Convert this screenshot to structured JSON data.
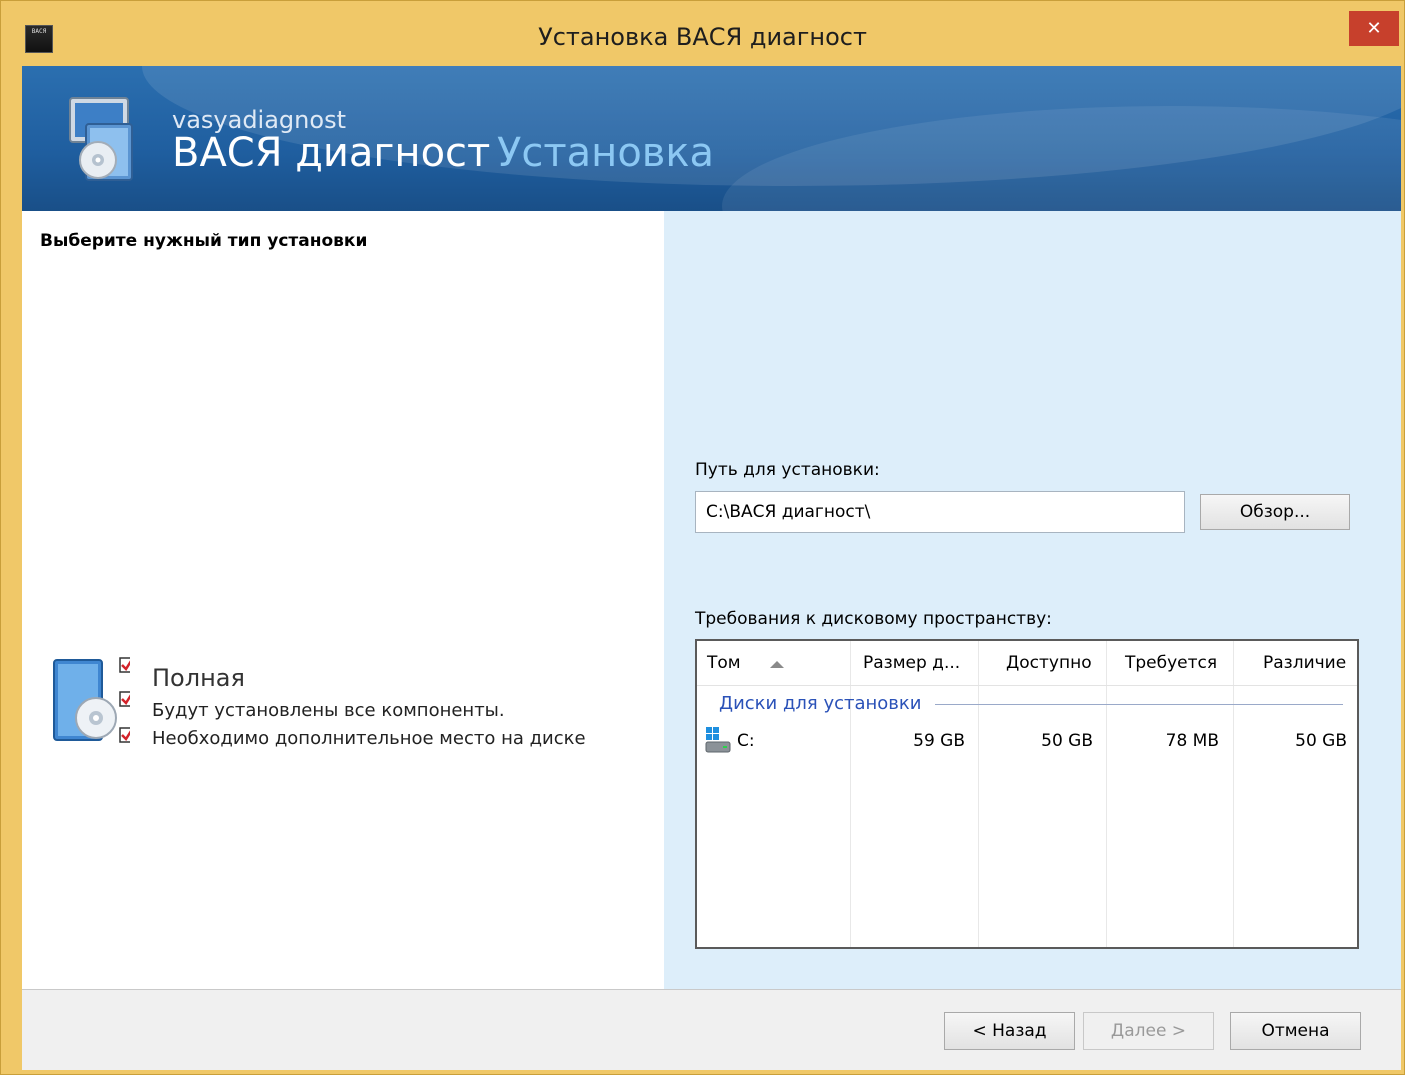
{
  "window": {
    "title": "Установка ВАСЯ диагност",
    "close_label": "✕",
    "app_icon_text": "ВАСЯ"
  },
  "banner": {
    "subtitle": "vasyadiagnost",
    "product": "ВАСЯ диагност",
    "step": "Установка"
  },
  "left_panel": {
    "heading": "Выберите нужный тип установки",
    "option": {
      "title": "Полная",
      "desc1": "Будут установлены все компоненты.",
      "desc2": "Необходимо дополнительное место на диске"
    }
  },
  "right_panel": {
    "path_label": "Путь для установки:",
    "path_value": "C:\\ВАСЯ диагност\\",
    "browse_label": "Обзор...",
    "requirements_label": "Требования к дисковому пространству:",
    "table": {
      "columns": [
        "Том",
        "Размер д...",
        "Доступно",
        "Требуется",
        "Различие"
      ],
      "group_label": "Диски для установки",
      "rows": [
        {
          "volume": "C:",
          "size": "59 GB",
          "available": "50 GB",
          "required": "78 MB",
          "difference": "50 GB"
        }
      ]
    }
  },
  "footer": {
    "back_label": "< Назад",
    "next_label": "Далее >",
    "cancel_label": "Отмена"
  },
  "colors": {
    "window_frame": "#f0c868",
    "banner": "#2265a6",
    "close_button": "#c7402c",
    "right_panel_bg": "#ddeefa",
    "group_text": "#2b52b8"
  }
}
